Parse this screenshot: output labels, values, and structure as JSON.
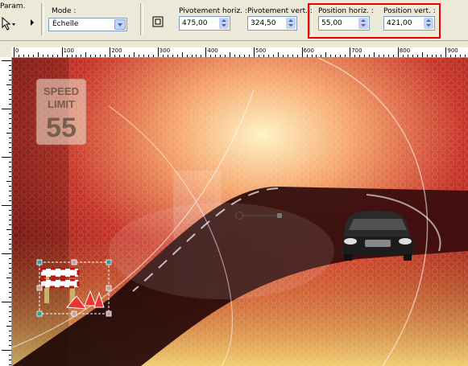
{
  "toolbar": {
    "param_label": "Param.",
    "mode_label": "Mode :",
    "mode_value": "Échelle",
    "pivot_h_label": "Pivotement horiz. :",
    "pivot_h_value": "475,00",
    "pivot_v_label": "Pivotement vert. :",
    "pivot_v_value": "324,50",
    "pos_h_label": "Position horiz. :",
    "pos_h_value": "55,00",
    "pos_v_label": "Position vert. :",
    "pos_v_value": "421,00"
  },
  "ruler": {
    "labels": [
      "0",
      "100",
      "200",
      "300",
      "400",
      "500",
      "600",
      "700",
      "800",
      "900"
    ]
  },
  "canvas": {
    "sign_line1": "SPEED",
    "sign_line2": "LIMIT",
    "sign_number": "55"
  },
  "colors": {
    "highlight": "#e00000",
    "handle": "#2aa198"
  }
}
